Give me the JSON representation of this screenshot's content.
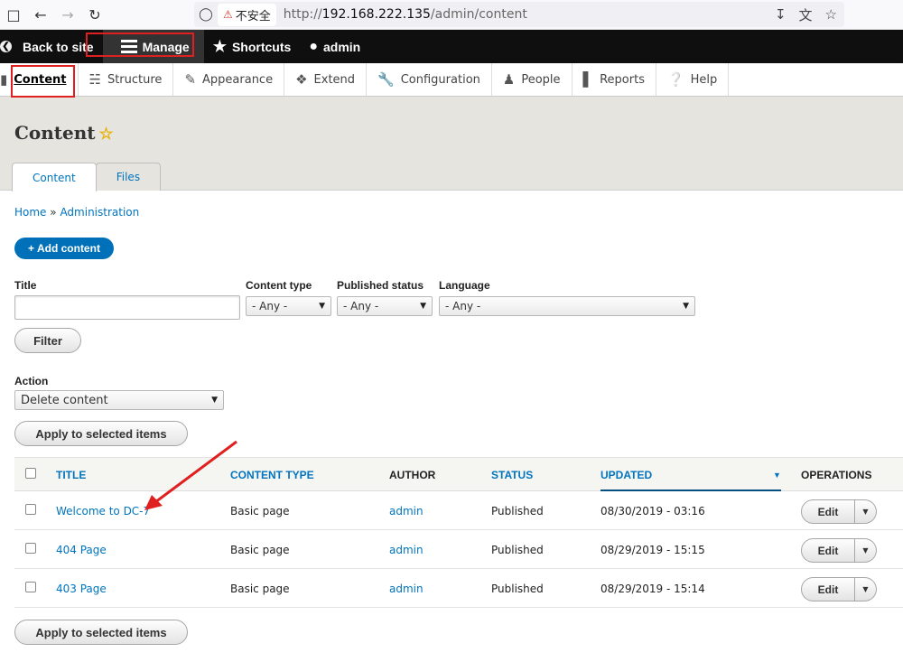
{
  "browser": {
    "insecure_label": "不安全",
    "url_prefix": "http://",
    "url_host": "192.168.222.135",
    "url_path": "/admin/content"
  },
  "toolbar": {
    "back_label": "Back to site",
    "manage_label": "Manage",
    "shortcuts_label": "Shortcuts",
    "user_label": "admin"
  },
  "tray": {
    "items": [
      {
        "label": "Content",
        "icon": "document-icon"
      },
      {
        "label": "Structure",
        "icon": "sitemap-icon"
      },
      {
        "label": "Appearance",
        "icon": "paintbrush-icon"
      },
      {
        "label": "Extend",
        "icon": "puzzle-icon"
      },
      {
        "label": "Configuration",
        "icon": "wrench-icon"
      },
      {
        "label": "People",
        "icon": "people-icon"
      },
      {
        "label": "Reports",
        "icon": "bar-chart-icon"
      },
      {
        "label": "Help",
        "icon": "help-icon"
      }
    ]
  },
  "page": {
    "title": "Content",
    "tabs": [
      "Content",
      "Files"
    ],
    "breadcrumb_home": "Home",
    "breadcrumb_sep": "»",
    "breadcrumb_admin": "Administration",
    "add_content": "+ Add content"
  },
  "filters": {
    "title_label": "Title",
    "title_value": "",
    "content_type_label": "Content type",
    "content_type_value": "- Any -",
    "published_label": "Published status",
    "published_value": "- Any -",
    "language_label": "Language",
    "language_value": "- Any -",
    "filter_button": "Filter"
  },
  "action": {
    "label": "Action",
    "value": "Delete content",
    "apply_label": "Apply to selected items"
  },
  "table": {
    "headers": {
      "title": "TITLE",
      "content_type": "CONTENT TYPE",
      "author": "AUTHOR",
      "status": "STATUS",
      "updated": "UPDATED",
      "operations": "OPERATIONS"
    },
    "rows": [
      {
        "title": "Welcome to DC-7",
        "type": "Basic page",
        "author": "admin",
        "status": "Published",
        "updated": "08/30/2019 - 03:16",
        "op": "Edit"
      },
      {
        "title": "404 Page",
        "type": "Basic page",
        "author": "admin",
        "status": "Published",
        "updated": "08/29/2019 - 15:15",
        "op": "Edit"
      },
      {
        "title": "403 Page",
        "type": "Basic page",
        "author": "admin",
        "status": "Published",
        "updated": "08/29/2019 - 15:14",
        "op": "Edit"
      }
    ]
  },
  "colors": {
    "accent": "#0074bd",
    "toolbar_bg": "#0f0f0f",
    "annotation_red": "#e02020"
  }
}
